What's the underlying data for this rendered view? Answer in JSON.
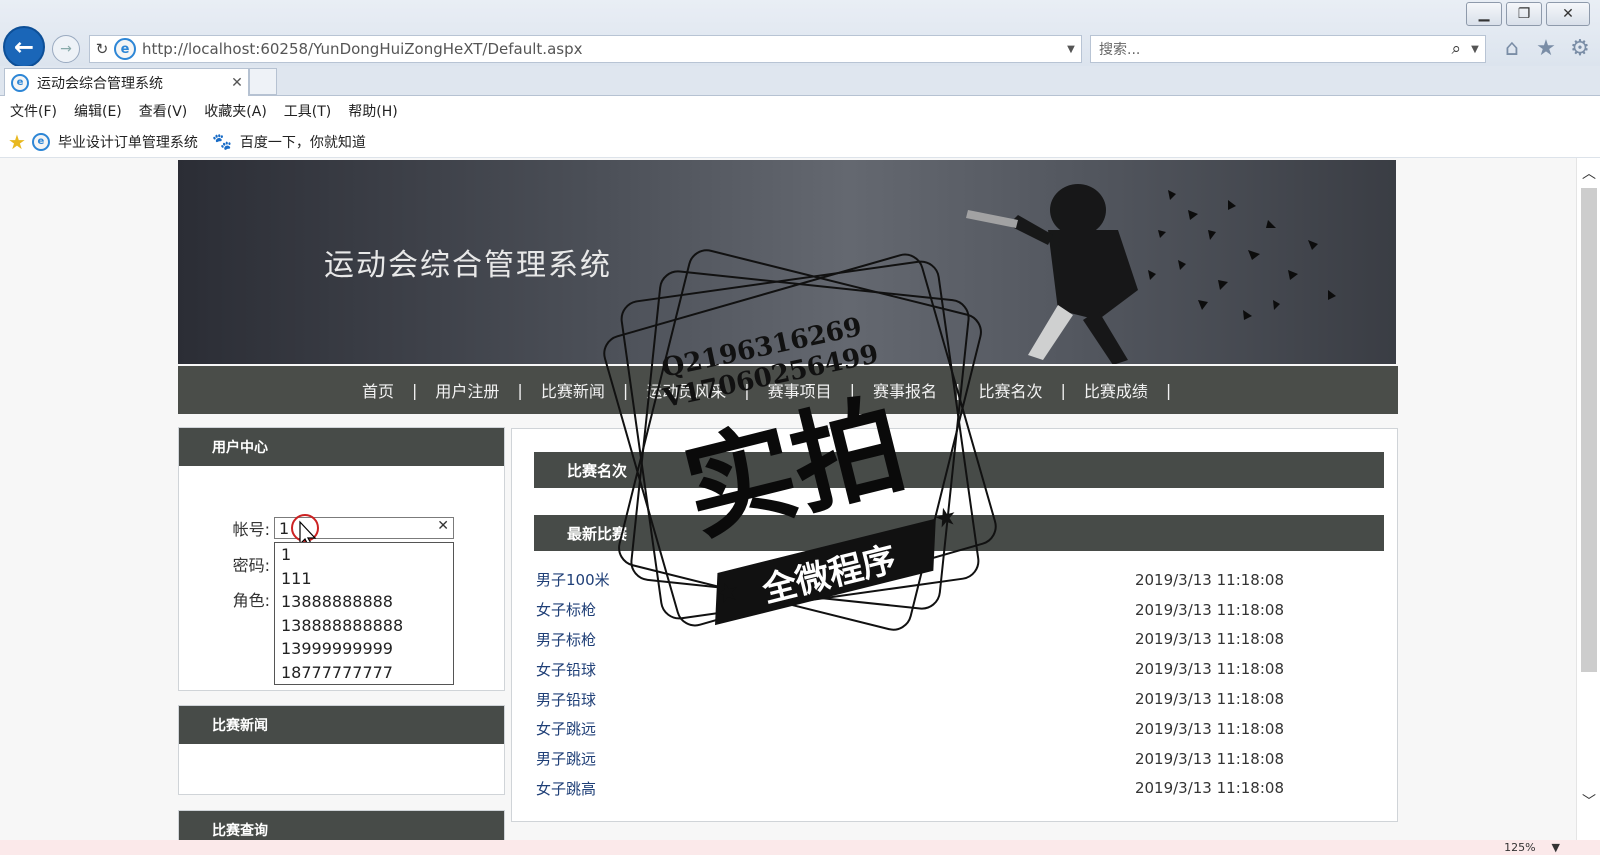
{
  "browser": {
    "address": "http://localhost:60258/YunDongHuiZongHeXT/Default.aspx",
    "search_placeholder": "搜索...",
    "tab_title": "运动会综合管理系统",
    "menu": [
      "文件(F)",
      "编辑(E)",
      "查看(V)",
      "收藏夹(A)",
      "工具(T)",
      "帮助(H)"
    ],
    "favorites": [
      "毕业设计订单管理系统",
      "百度一下，你就知道"
    ],
    "zoom": "125%"
  },
  "site": {
    "title": "运动会综合管理系统",
    "nav": [
      "首页",
      "用户注册",
      "比赛新闻",
      "运动员风采",
      "赛事项目",
      "赛事报名",
      "比赛名次",
      "比赛成绩"
    ]
  },
  "login": {
    "heading": "用户中心",
    "account_label": "帐号:",
    "account_value": "1",
    "password_label": "密码:",
    "role_label": "角色:",
    "suggestions": [
      "1",
      "111",
      "13888888888",
      "138888888888",
      "13999999999",
      "18777777777"
    ]
  },
  "news": {
    "heading": "比赛新闻"
  },
  "query": {
    "heading": "比赛查询"
  },
  "main": {
    "rank_heading": "比赛名次",
    "latest_heading": "最新比赛",
    "games": [
      {
        "name": "男子100米",
        "time": "2019/3/13 11:18:08"
      },
      {
        "name": "女子标枪",
        "time": "2019/3/13 11:18:08"
      },
      {
        "name": "男子标枪",
        "time": "2019/3/13 11:18:08"
      },
      {
        "name": "女子铅球",
        "time": "2019/3/13 11:18:08"
      },
      {
        "name": "男子铅球",
        "time": "2019/3/13 11:18:08"
      },
      {
        "name": "女子跳远",
        "time": "2019/3/13 11:18:08"
      },
      {
        "name": "男子跳远",
        "time": "2019/3/13 11:18:08"
      },
      {
        "name": "女子跳高",
        "time": "2019/3/13 11:18:08"
      }
    ]
  },
  "watermark": {
    "line1": "Q2196316269",
    "line2": "V17060256499",
    "big": "实拍",
    "ribbon": "全微程序"
  },
  "icons": {
    "back": "back-arrow-icon",
    "forward": "forward-arrow-icon",
    "refresh": "refresh-icon",
    "home": "home-icon",
    "favorites": "star-icon",
    "settings": "gear-icon"
  }
}
